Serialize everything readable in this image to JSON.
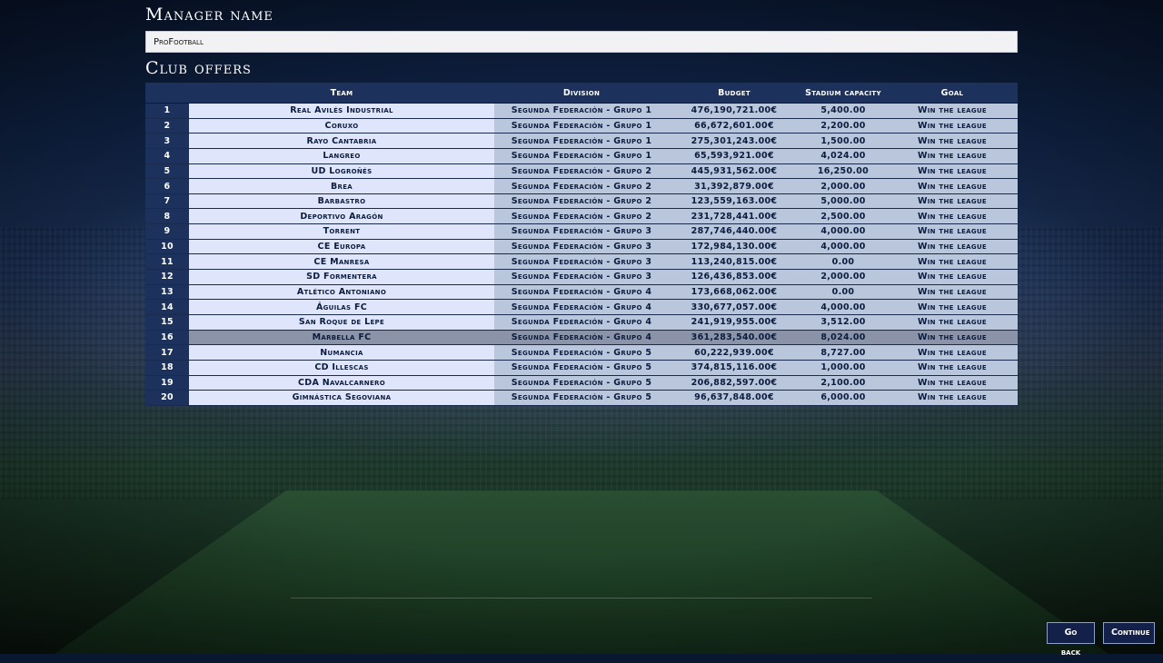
{
  "manager": {
    "heading": "Manager name",
    "name_value": "ProFootball"
  },
  "offers": {
    "heading": "Club offers",
    "columns": {
      "num": "",
      "team": "Team",
      "division": "Division",
      "budget": "Budget",
      "stadium": "Stadium capacity",
      "goal": "Goal"
    },
    "selected_row": 16,
    "rows": [
      {
        "num": "1",
        "team": "Real Avilés Industrial",
        "division": "Segunda Federación - Grupo 1",
        "budget": "476,190,721.00€",
        "stadium": "5,400.00",
        "goal": "Win the league"
      },
      {
        "num": "2",
        "team": "Coruxo",
        "division": "Segunda Federación - Grupo 1",
        "budget": "66,672,601.00€",
        "stadium": "2,200.00",
        "goal": "Win the league"
      },
      {
        "num": "3",
        "team": "Rayo Cantabria",
        "division": "Segunda Federación - Grupo 1",
        "budget": "275,301,243.00€",
        "stadium": "1,500.00",
        "goal": "Win the league"
      },
      {
        "num": "4",
        "team": "Langreo",
        "division": "Segunda Federación - Grupo 1",
        "budget": "65,593,921.00€",
        "stadium": "4,024.00",
        "goal": "Win the league"
      },
      {
        "num": "5",
        "team": "UD Logroñés",
        "division": "Segunda Federación - Grupo 2",
        "budget": "445,931,562.00€",
        "stadium": "16,250.00",
        "goal": "Win the league"
      },
      {
        "num": "6",
        "team": "Brea",
        "division": "Segunda Federación - Grupo 2",
        "budget": "31,392,879.00€",
        "stadium": "2,000.00",
        "goal": "Win the league"
      },
      {
        "num": "7",
        "team": "Barbastro",
        "division": "Segunda Federación - Grupo 2",
        "budget": "123,559,163.00€",
        "stadium": "5,000.00",
        "goal": "Win the league"
      },
      {
        "num": "8",
        "team": "Deportivo Aragón",
        "division": "Segunda Federación - Grupo 2",
        "budget": "231,728,441.00€",
        "stadium": "2,500.00",
        "goal": "Win the league"
      },
      {
        "num": "9",
        "team": "Torrent",
        "division": "Segunda Federación - Grupo 3",
        "budget": "287,746,440.00€",
        "stadium": "4,000.00",
        "goal": "Win the league"
      },
      {
        "num": "10",
        "team": "CE Europa",
        "division": "Segunda Federación - Grupo 3",
        "budget": "172,984,130.00€",
        "stadium": "4,000.00",
        "goal": "Win the league"
      },
      {
        "num": "11",
        "team": "CE Manresa",
        "division": "Segunda Federación - Grupo 3",
        "budget": "113,240,815.00€",
        "stadium": "0.00",
        "goal": "Win the league"
      },
      {
        "num": "12",
        "team": "SD Formentera",
        "division": "Segunda Federación - Grupo 3",
        "budget": "126,436,853.00€",
        "stadium": "2,000.00",
        "goal": "Win the league"
      },
      {
        "num": "13",
        "team": "Atlético Antoniano",
        "division": "Segunda Federación - Grupo 4",
        "budget": "173,668,062.00€",
        "stadium": "0.00",
        "goal": "Win the league"
      },
      {
        "num": "14",
        "team": "Águilas FC",
        "division": "Segunda Federación - Grupo 4",
        "budget": "330,677,057.00€",
        "stadium": "4,000.00",
        "goal": "Win the league"
      },
      {
        "num": "15",
        "team": "San Roque de Lepe",
        "division": "Segunda Federación - Grupo 4",
        "budget": "241,919,955.00€",
        "stadium": "3,512.00",
        "goal": "Win the league"
      },
      {
        "num": "16",
        "team": "Marbella FC",
        "division": "Segunda Federación - Grupo 4",
        "budget": "361,283,540.00€",
        "stadium": "8,024.00",
        "goal": "Win the league"
      },
      {
        "num": "17",
        "team": "Numancia",
        "division": "Segunda Federación - Grupo 5",
        "budget": "60,222,939.00€",
        "stadium": "8,727.00",
        "goal": "Win the league"
      },
      {
        "num": "18",
        "team": "CD Illescas",
        "division": "Segunda Federación - Grupo 5",
        "budget": "374,815,116.00€",
        "stadium": "1,000.00",
        "goal": "Win the league"
      },
      {
        "num": "19",
        "team": "CDA Navalcarnero",
        "division": "Segunda Federación - Grupo 5",
        "budget": "206,882,597.00€",
        "stadium": "2,100.00",
        "goal": "Win the league"
      },
      {
        "num": "20",
        "team": "Gimnástica Segoviana",
        "division": "Segunda Federación - Grupo 5",
        "budget": "96,637,848.00€",
        "stadium": "6,000.00",
        "goal": "Win the league"
      }
    ]
  },
  "buttons": {
    "go_back": "Go back",
    "continue": "Continue"
  },
  "colors": {
    "header_bg": "#1c315c",
    "team_cell_bg": "#dfe6fb",
    "data_cell_bg": "#b9c6dc",
    "selected_row_bg": "#8a93a8",
    "button_bg": "#12204a"
  }
}
